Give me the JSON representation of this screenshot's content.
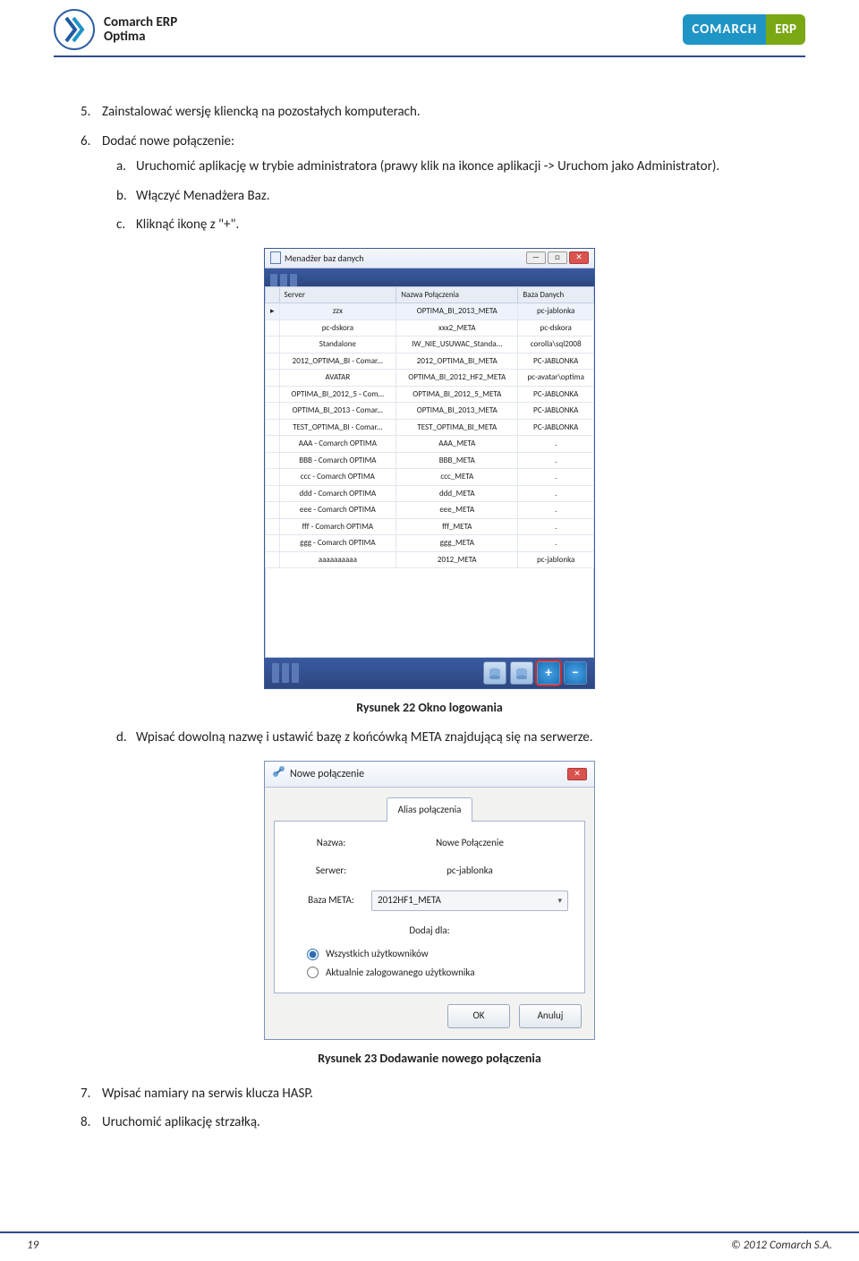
{
  "header": {
    "left_logo_line1": "Comarch ERP",
    "left_logo_line2": "Optima",
    "right_badge_1": "COMARCH",
    "right_badge_2": "ERP"
  },
  "list": {
    "item5_num": "5.",
    "item5": "Zainstalować wersję kliencką na pozostałych komputerach.",
    "item6_num": "6.",
    "item6": "Dodać nowe połączenie:",
    "sub_a_mark": "a.",
    "sub_a": "Uruchomić aplikację w trybie administratora (prawy klik na ikonce aplikacji -> Uruchom jako Administrator).",
    "sub_b_mark": "b.",
    "sub_b": "Włączyć Menadżera Baz.",
    "sub_c_mark": "c.",
    "sub_c": "Kliknąć ikonę z \"+\".",
    "sub_d_mark": "d.",
    "sub_d": "Wpisać dowolną nazwę i ustawić bazę z końcówką META znajdującą się na serwerze.",
    "item7_num": "7.",
    "item7": "Wpisać namiary na serwis klucza HASP.",
    "item8_num": "8.",
    "item8": "Uruchomić aplikację strzałką."
  },
  "caption1": "Rysunek 22 Okno logowania",
  "caption2": "Rysunek 23 Dodawanie nowego połączenia",
  "win1": {
    "title": "Menadżer baz danych",
    "columns": [
      "",
      "Server",
      "Nazwa Połączenia",
      "Baza Danych"
    ],
    "rows": [
      [
        "▸",
        "zzx",
        "OPTIMA_BI_2013_META",
        "pc-jablonka"
      ],
      [
        "",
        "pc-dskora",
        "xxx2_META",
        "pc-dskora"
      ],
      [
        "",
        "Standalone",
        "IW_NIE_USUWAC_Standa...",
        "corolla\\sql2008"
      ],
      [
        "",
        "2012_OPTIMA_BI - Comar...",
        "2012_OPTIMA_BI_META",
        "PC-JABLONKA"
      ],
      [
        "",
        "AVATAR",
        "OPTIMA_BI_2012_HF2_META",
        "pc-avatar\\optima"
      ],
      [
        "",
        "OPTIMA_BI_2012_5 - Com...",
        "OPTIMA_BI_2012_5_META",
        "PC-JABLONKA"
      ],
      [
        "",
        "OPTIMA_BI_2013 - Comar...",
        "OPTIMA_BI_2013_META",
        "PC-JABLONKA"
      ],
      [
        "",
        "TEST_OPTIMA_BI - Comar...",
        "TEST_OPTIMA_BI_META",
        "PC-JABLONKA"
      ],
      [
        "",
        "AAA - Comarch OPTIMA",
        "AAA_META",
        "."
      ],
      [
        "",
        "BBB - Comarch OPTIMA",
        "BBB_META",
        "."
      ],
      [
        "",
        "ccc - Comarch OPTIMA",
        "ccc_META",
        "."
      ],
      [
        "",
        "ddd - Comarch OPTIMA",
        "ddd_META",
        "."
      ],
      [
        "",
        "eee - Comarch OPTIMA",
        "eee_META",
        "."
      ],
      [
        "",
        "fff - Comarch OPTIMA",
        "fff_META",
        "."
      ],
      [
        "",
        "ggg - Comarch OPTIMA",
        "ggg_META",
        "."
      ],
      [
        "",
        "aaaaaaaaaa",
        "2012_META",
        "pc-jablonka"
      ]
    ]
  },
  "win2": {
    "title": "Nowe połączenie",
    "tab": "Alias połączenia",
    "label_name": "Nazwa:",
    "value_name": "Nowe Połączenie",
    "label_server": "Serwer:",
    "value_server": "pc-jablonka",
    "label_base": "Baza META:",
    "value_base": "2012HF1_META",
    "label_addfor": "Dodaj dla:",
    "radio_all": "Wszystkich użytkowników",
    "radio_current": "Aktualnie zalogowanego użytkownika",
    "btn_ok": "OK",
    "btn_cancel": "Anuluj"
  },
  "footer": {
    "page": "19",
    "copyright": "© 2012 Comarch S.A."
  }
}
